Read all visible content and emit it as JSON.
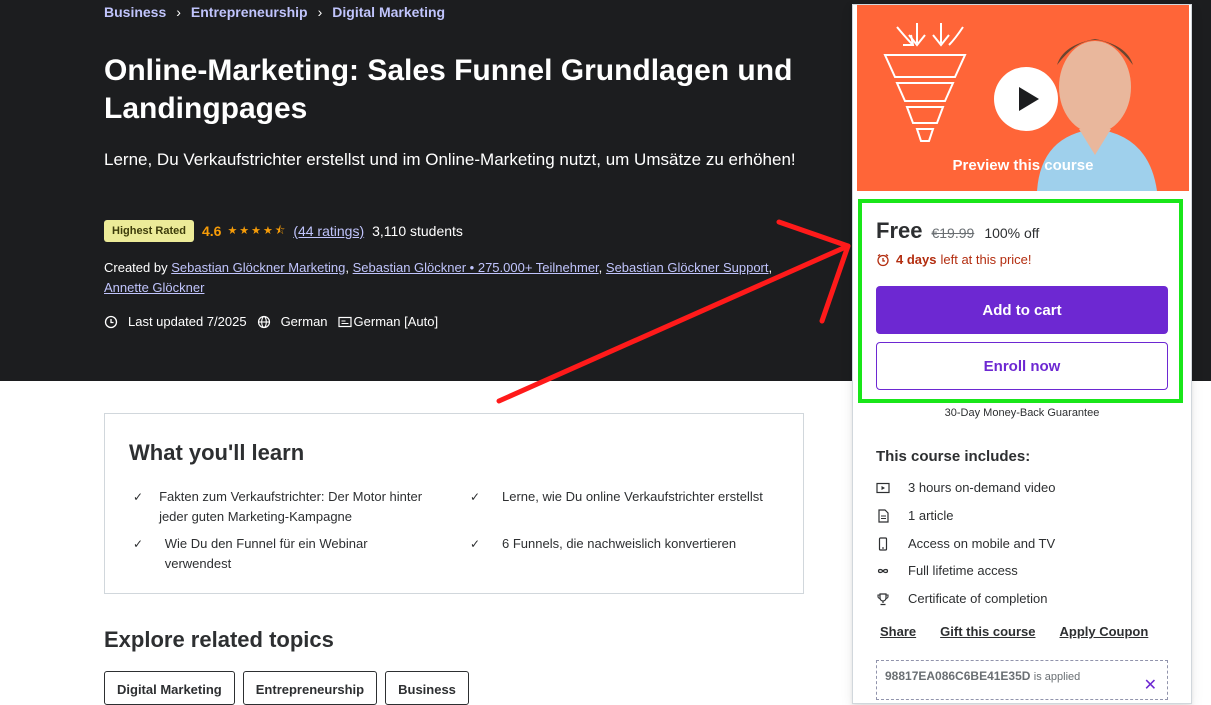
{
  "breadcrumb": [
    "Business",
    "Entrepreneurship",
    "Digital Marketing"
  ],
  "course": {
    "title": "Online-Marketing: Sales Funnel Grundlagen und Landingpages",
    "subtitle": "Lerne, Du Verkaufstrichter erstellst und im Online-Marketing nutzt, um Umsätze zu erhöhen!",
    "badge": "Highest Rated",
    "rating": "4.6",
    "stars": "★★★★⯪",
    "ratings_link": "(44 ratings)",
    "students": "3,110 students",
    "created_by_label": "Created by",
    "instructors": [
      "Sebastian Glöckner Marketing",
      "Sebastian Glöckner • 275.000+ Teilnehmer",
      "Sebastian Glöckner Support",
      "Annette Glöckner"
    ],
    "last_updated": "Last updated 7/2025",
    "language": "German",
    "captions": "German [Auto]"
  },
  "learn": {
    "heading": "What you'll learn",
    "items": [
      "Fakten zum Verkaufstrichter: Der Motor hinter jeder guten Marketing-Kampagne",
      "Lerne, wie Du online Verkaufstrichter erstellst",
      "Wie Du den Funnel für ein Webinar verwendest",
      "6 Funnels, die nachweislich konvertieren"
    ]
  },
  "explore": {
    "heading": "Explore related topics",
    "topics": [
      "Digital Marketing",
      "Entrepreneurship",
      "Business"
    ]
  },
  "sidebar": {
    "preview_label": "Preview this course",
    "price": "Free",
    "original_price": "€19.99",
    "discount": "100% off",
    "timer_days": "4 days",
    "timer_rest": "left at this price!",
    "add_to_cart": "Add to cart",
    "enroll_now": "Enroll now",
    "guarantee": "30-Day Money-Back Guarantee",
    "includes_title": "This course includes:",
    "includes": [
      {
        "icon": "video-icon",
        "text": "3 hours on-demand video"
      },
      {
        "icon": "article-icon",
        "text": "1 article"
      },
      {
        "icon": "mobile-icon",
        "text": "Access on mobile and TV"
      },
      {
        "icon": "infinity-icon",
        "text": "Full lifetime access"
      },
      {
        "icon": "trophy-icon",
        "text": "Certificate of completion"
      }
    ],
    "links": [
      "Share",
      "Gift this course",
      "Apply Coupon"
    ],
    "coupon_code": "98817EA086C6BE41E35D",
    "coupon_applied": "is applied"
  },
  "colors": {
    "accent": "#6d28d2",
    "annotation_box": "#19e619",
    "annotation_arrow": "#ff1a1a",
    "hero_bg": "#1c1d1f"
  }
}
